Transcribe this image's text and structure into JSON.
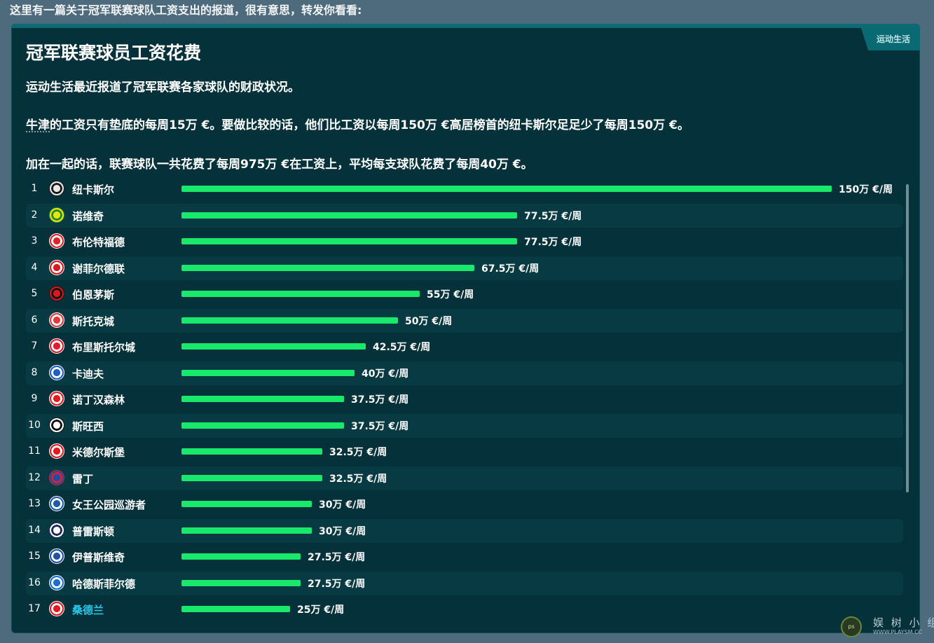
{
  "intro_text": "这里有一篇关于冠军联赛球队工资支出的报道，很有意思，转发你看看:",
  "card": {
    "tag": "运动生活",
    "title": "冠军联赛球员工资花费",
    "paragraph1": "运动生活最近报道了冠军联赛各家球队的财政状况。",
    "paragraph2_team": "牛津",
    "paragraph2_rest": "的工资只有垫底的每周15万 €。要做比较的话，他们比工资以每周150万 €高居榜首的纽卡斯尔足足少了每周150万 €。",
    "paragraph3": "加在一起的话，联赛球队一共花费了每周975万 €在工资上，平均每支球队花费了每周40万 €。"
  },
  "list": {
    "max_value": 150,
    "rows": [
      {
        "rank": "1",
        "team": "纽卡斯尔",
        "value": 150,
        "label": "150万 €/周",
        "crest": "newcastle-crest-icon",
        "c1": "#e8e8e8",
        "c2": "#1a1a1a"
      },
      {
        "rank": "2",
        "team": "诺维奇",
        "value": 77.5,
        "label": "77.5万 €/周",
        "crest": "norwich-crest-icon",
        "c1": "#f2e400",
        "c2": "#1f8a3a"
      },
      {
        "rank": "3",
        "team": "布伦特福德",
        "value": 77.5,
        "label": "77.5万 €/周",
        "crest": "brentford-crest-icon",
        "c1": "#e3212b",
        "c2": "#ffffff"
      },
      {
        "rank": "4",
        "team": "谢菲尔德联",
        "value": 67.5,
        "label": "67.5万 €/周",
        "crest": "sheffield-united-crest-icon",
        "c1": "#d71920",
        "c2": "#ffffff"
      },
      {
        "rank": "5",
        "team": "伯恩茅斯",
        "value": 55,
        "label": "55万 €/周",
        "crest": "bournemouth-crest-icon",
        "c1": "#d8191f",
        "c2": "#111111"
      },
      {
        "rank": "6",
        "team": "斯托克城",
        "value": 50,
        "label": "50万 €/周",
        "crest": "stoke-crest-icon",
        "c1": "#e03a3e",
        "c2": "#ffffff"
      },
      {
        "rank": "7",
        "team": "布里斯托尔城",
        "value": 42.5,
        "label": "42.5万 €/周",
        "crest": "bristol-city-crest-icon",
        "c1": "#e21c2f",
        "c2": "#ffffff"
      },
      {
        "rank": "8",
        "team": "卡迪夫",
        "value": 40,
        "label": "40万 €/周",
        "crest": "cardiff-crest-icon",
        "c1": "#1f5fc2",
        "c2": "#ffffff"
      },
      {
        "rank": "9",
        "team": "诺丁汉森林",
        "value": 37.5,
        "label": "37.5万 €/周",
        "crest": "forest-crest-icon",
        "c1": "#e31b23",
        "c2": "#ffffff"
      },
      {
        "rank": "10",
        "team": "斯旺西",
        "value": 37.5,
        "label": "37.5万 €/周",
        "crest": "swansea-crest-icon",
        "c1": "#ffffff",
        "c2": "#111111"
      },
      {
        "rank": "11",
        "team": "米德尔斯堡",
        "value": 32.5,
        "label": "32.5万 €/周",
        "crest": "middlesbrough-crest-icon",
        "c1": "#e11b22",
        "c2": "#ffffff"
      },
      {
        "rank": "12",
        "team": "雷丁",
        "value": 32.5,
        "label": "32.5万 €/周",
        "crest": "reading-crest-icon",
        "c1": "#1a4fa3",
        "c2": "#e21c2f"
      },
      {
        "rank": "13",
        "team": "女王公园巡游者",
        "value": 30,
        "label": "30万 €/周",
        "crest": "qpr-crest-icon",
        "c1": "#1d5ba8",
        "c2": "#ffffff"
      },
      {
        "rank": "14",
        "team": "普雷斯顿",
        "value": 30,
        "label": "30万 €/周",
        "crest": "preston-crest-icon",
        "c1": "#ffffff",
        "c2": "#1b2a5e"
      },
      {
        "rank": "15",
        "team": "伊普斯维奇",
        "value": 27.5,
        "label": "27.5万 €/周",
        "crest": "ipswich-crest-icon",
        "c1": "#1f52a5",
        "c2": "#ffffff"
      },
      {
        "rank": "16",
        "team": "哈德斯菲尔德",
        "value": 27.5,
        "label": "27.5万 €/周",
        "crest": "huddersfield-crest-icon",
        "c1": "#1c6fd1",
        "c2": "#ffffff"
      },
      {
        "rank": "17",
        "team": "桑德兰",
        "value": 25,
        "label": "25万 €/周",
        "crest": "sunderland-crest-icon",
        "c1": "#e21b23",
        "c2": "#ffffff",
        "link": true
      }
    ]
  },
  "watermark": {
    "text": "娱 树 小 组",
    "sub": "WWW.PLAYSM.CC",
    "logo": "ps"
  }
}
